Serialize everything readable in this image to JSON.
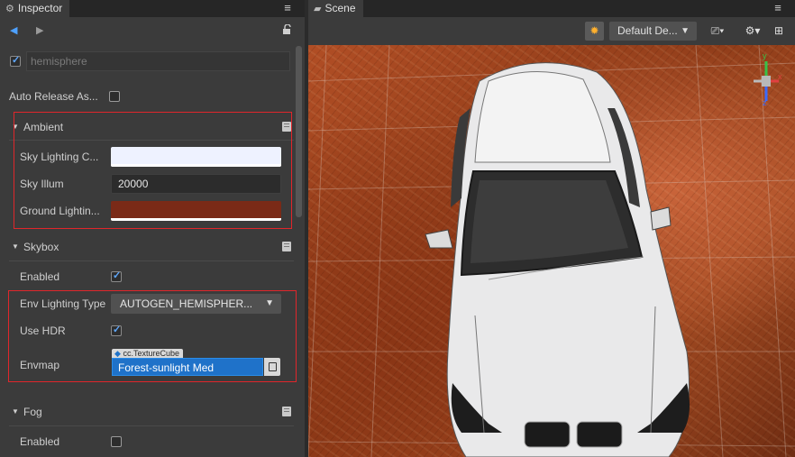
{
  "inspector": {
    "tab_title": "Inspector",
    "node_enabled": true,
    "node_name": "hemisphere",
    "auto_release_label": "Auto Release As...",
    "auto_release_checked": false,
    "ambient": {
      "title": "Ambient",
      "sky_lighting_label": "Sky Lighting C...",
      "sky_lighting_color": "#eef2ff",
      "sky_illum_label": "Sky Illum",
      "sky_illum_value": "20000",
      "ground_lighting_label": "Ground Lightin...",
      "ground_lighting_color": "#7a2a17"
    },
    "skybox": {
      "title": "Skybox",
      "enabled_label": "Enabled",
      "enabled_checked": true,
      "env_lighting_label": "Env Lighting Type",
      "env_lighting_value": "AUTOGEN_HEMISPHER...",
      "use_hdr_label": "Use HDR",
      "use_hdr_checked": true,
      "envmap_label": "Envmap",
      "envmap_type": "cc.TextureCube",
      "envmap_value": "Forest-sunlight Med"
    },
    "fog": {
      "title": "Fog",
      "enabled_label": "Enabled",
      "enabled_checked": false
    }
  },
  "scene": {
    "tab_title": "Scene",
    "camera_dropdown": "Default De...",
    "gizmo_axes": {
      "y": "y",
      "x": "x",
      "z": "z"
    }
  },
  "colors": {
    "highlight_border": "#e0262b",
    "asset_field": "#1f72c9"
  }
}
